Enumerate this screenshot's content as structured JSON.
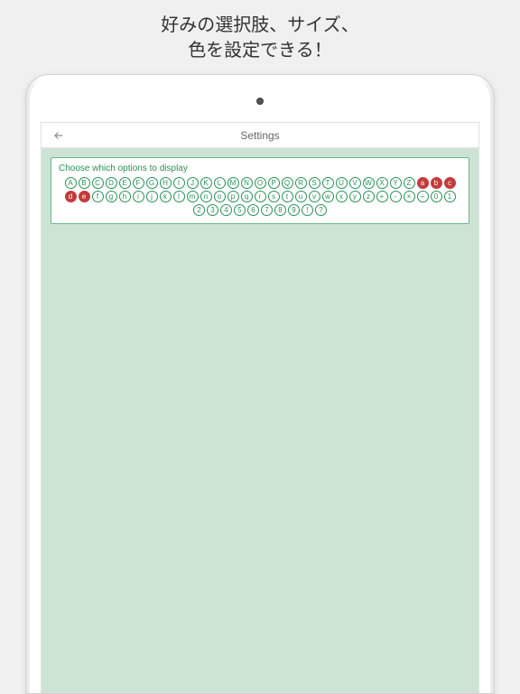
{
  "promo": {
    "line1": "好みの選択肢、サイズ、",
    "line2": "色を設定できる！"
  },
  "header": {
    "title": "Settings"
  },
  "panel": {
    "label": "Choose which options to display"
  },
  "options": [
    {
      "t": "A",
      "s": false
    },
    {
      "t": "B",
      "s": false
    },
    {
      "t": "C",
      "s": false
    },
    {
      "t": "D",
      "s": false
    },
    {
      "t": "E",
      "s": false
    },
    {
      "t": "F",
      "s": false
    },
    {
      "t": "G",
      "s": false
    },
    {
      "t": "H",
      "s": false
    },
    {
      "t": "I",
      "s": false
    },
    {
      "t": "J",
      "s": false
    },
    {
      "t": "K",
      "s": false
    },
    {
      "t": "L",
      "s": false
    },
    {
      "t": "M",
      "s": false
    },
    {
      "t": "N",
      "s": false
    },
    {
      "t": "O",
      "s": false
    },
    {
      "t": "P",
      "s": false
    },
    {
      "t": "Q",
      "s": false
    },
    {
      "t": "R",
      "s": false
    },
    {
      "t": "S",
      "s": false
    },
    {
      "t": "T",
      "s": false
    },
    {
      "t": "U",
      "s": false
    },
    {
      "t": "V",
      "s": false
    },
    {
      "t": "W",
      "s": false
    },
    {
      "t": "X",
      "s": false
    },
    {
      "t": "Y",
      "s": false
    },
    {
      "t": "Z",
      "s": false
    },
    {
      "t": "a",
      "s": true
    },
    {
      "t": "b",
      "s": true
    },
    {
      "t": "c",
      "s": true
    },
    {
      "t": "d",
      "s": true
    },
    {
      "t": "e",
      "s": true
    },
    {
      "t": "f",
      "s": false
    },
    {
      "t": "g",
      "s": false
    },
    {
      "t": "h",
      "s": false
    },
    {
      "t": "i",
      "s": false
    },
    {
      "t": "j",
      "s": false
    },
    {
      "t": "k",
      "s": false
    },
    {
      "t": "l",
      "s": false
    },
    {
      "t": "m",
      "s": false
    },
    {
      "t": "n",
      "s": false
    },
    {
      "t": "o",
      "s": false
    },
    {
      "t": "p",
      "s": false
    },
    {
      "t": "q",
      "s": false
    },
    {
      "t": "r",
      "s": false
    },
    {
      "t": "s",
      "s": false
    },
    {
      "t": "t",
      "s": false
    },
    {
      "t": "u",
      "s": false
    },
    {
      "t": "v",
      "s": false
    },
    {
      "t": "w",
      "s": false
    },
    {
      "t": "x",
      "s": false
    },
    {
      "t": "y",
      "s": false
    },
    {
      "t": "z",
      "s": false
    },
    {
      "t": "+",
      "s": false
    },
    {
      "t": "-",
      "s": false
    },
    {
      "t": "×",
      "s": false
    },
    {
      "t": "÷",
      "s": false
    },
    {
      "t": "0",
      "s": false
    },
    {
      "t": "1",
      "s": false
    },
    {
      "t": "2",
      "s": false
    },
    {
      "t": "3",
      "s": false
    },
    {
      "t": "4",
      "s": false
    },
    {
      "t": "5",
      "s": false
    },
    {
      "t": "6",
      "s": false
    },
    {
      "t": "7",
      "s": false
    },
    {
      "t": "8",
      "s": false
    },
    {
      "t": "9",
      "s": false
    },
    {
      "t": "!",
      "s": false
    },
    {
      "t": "?",
      "s": false
    }
  ]
}
